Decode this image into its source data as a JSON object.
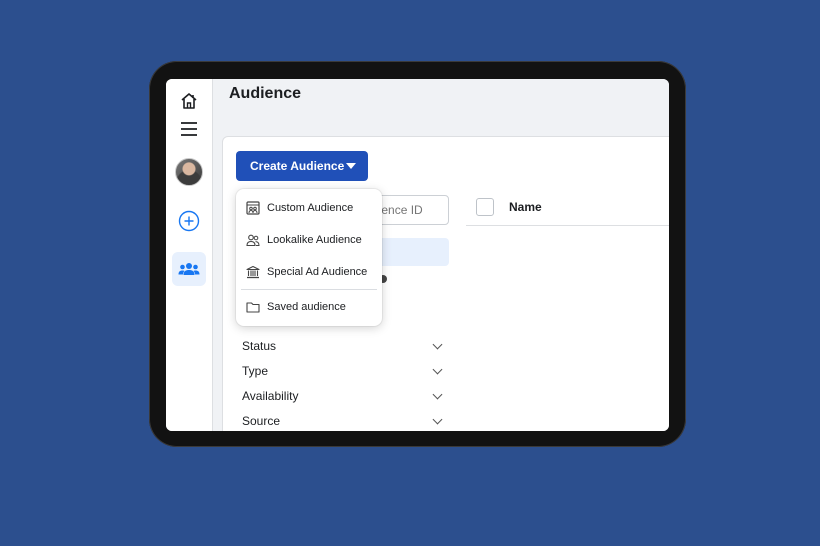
{
  "page": {
    "title": "Audience"
  },
  "sidebar": {
    "icons": [
      "home-icon",
      "menu-icon",
      "avatar",
      "add-icon",
      "audience-icon"
    ],
    "active_color": "#1877f2"
  },
  "toolbar": {
    "create_label": "Create Audience"
  },
  "search": {
    "placeholder": "dience ID"
  },
  "dropdown": {
    "items": [
      {
        "label": "Custom Audience",
        "icon": "custom-audience-icon"
      },
      {
        "label": "Lookalike Audience",
        "icon": "lookalike-icon"
      },
      {
        "label": "Special Ad Audience",
        "icon": "institution-icon"
      },
      {
        "label": "Saved audience",
        "icon": "folder-icon"
      }
    ]
  },
  "filters": [
    {
      "label": "Status"
    },
    {
      "label": "Type"
    },
    {
      "label": "Availability"
    },
    {
      "label": "Source"
    }
  ],
  "table": {
    "columns": [
      "Name"
    ]
  },
  "colors": {
    "brand": "#2050b8",
    "background": "#2c4f8e",
    "highlight": "#e7f0fd"
  }
}
